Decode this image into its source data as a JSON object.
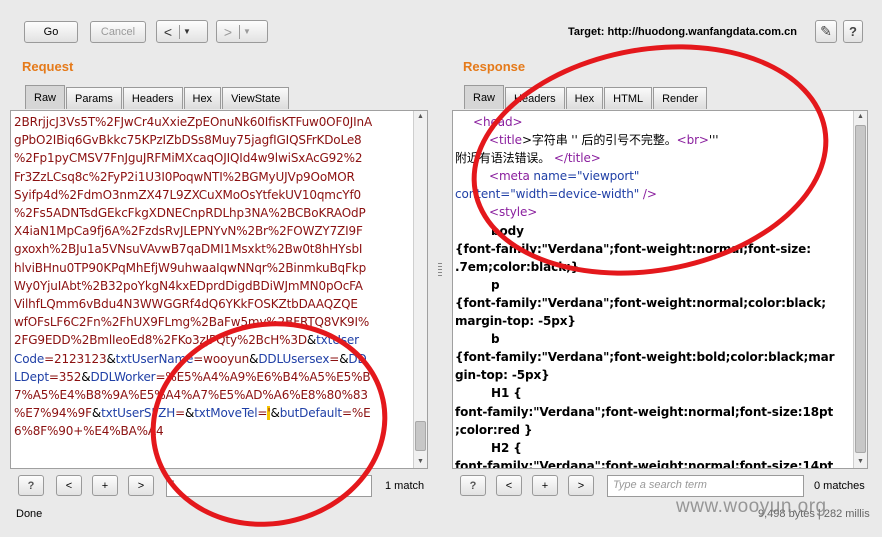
{
  "toolbar": {
    "go_label": "Go",
    "cancel_label": "Cancel",
    "back_symbol": "<",
    "forward_symbol": ">",
    "dropdown_symbol": "▼",
    "target_label": "Target: http://huodong.wanfangdata.com.cn",
    "edit_icon": "✎",
    "help_label": "?"
  },
  "request": {
    "title": "Request",
    "tabs": [
      "Raw",
      "Params",
      "Headers",
      "Hex",
      "ViewState"
    ],
    "active_tab": "Raw",
    "lines": [
      [
        {
          "t": "2BRrjjcJ3Vs5T%2FJwCr4uXxieZpEOnuNk60IfisKTFuw0OF0JInA",
          "c": "r"
        }
      ],
      [
        {
          "t": "gPbO2IBiq6GvBkkc75KPzIZbDSs8Muy75jagfIGIQSFrKDoLe8",
          "c": "r"
        }
      ],
      [
        {
          "t": "%2Fp1pyCMSV7FnJguJRFMiMXcaqOJIQId4w9lwiSxAcG92%2",
          "c": "r"
        }
      ],
      [
        {
          "t": "Fr3ZzLCsq8c%2FyP2i1U3I0PoqwNTI%2BGMyUJVp9OoMOR",
          "c": "r"
        }
      ],
      [
        {
          "t": "Syifp4d%2FdmO3nmZX47L9ZXCuXMoOsYtfekUV10qmcYf0",
          "c": "r"
        }
      ],
      [
        {
          "t": "%2Fs5ADNTsdGEkcFkgXDNECnpRDLhp3NA%2BCBoKRAOdP",
          "c": "r"
        }
      ],
      [
        {
          "t": "X4iaN1MpCa9fj6A%2FzdsRvJLEPNYvN%2Br%2FOWZY7ZI9F",
          "c": "r"
        }
      ],
      [
        {
          "t": "gxoxh%2BJu1a5VNsuVAvwB7qaDMI1Msxkt%2Bw0t8hHYsbI",
          "c": "r"
        }
      ],
      [
        {
          "t": "hlviBHnu0TP90KPqMhEfjW9uhwaaIqwNNqr%2BinmkuBqFkp",
          "c": "r"
        }
      ],
      [
        {
          "t": "Wy0YjuIAbt%2B32poYkgN4kxEDprdDigdBDiWJmMN0pOcFA",
          "c": "r"
        }
      ],
      [
        {
          "t": "VilhfLQmm6vBdu4N3WWGGRf4dQ6YKkFOSKZtbDAAQZQE",
          "c": "r"
        }
      ],
      [
        {
          "t": "wfOFsLF6C2Fn%2FhUX9FLmg%2BaFw5mv%2BFRTQ8VK9I%",
          "c": "r"
        }
      ],
      [
        {
          "t": "2FG9EDD%2BmlIeoEd8%2FKo3zJPQty%2BcH%3D",
          "c": "r"
        },
        {
          "t": "&",
          "c": "k"
        },
        {
          "t": "txtUser",
          "c": "b"
        }
      ],
      [
        {
          "t": "Code",
          "c": "b"
        },
        {
          "t": "=2123123",
          "c": "r"
        },
        {
          "t": "&",
          "c": "k"
        },
        {
          "t": "txtUserName",
          "c": "b"
        },
        {
          "t": "=wooyun",
          "c": "r"
        },
        {
          "t": "&",
          "c": "k"
        },
        {
          "t": "DDLUsersex",
          "c": "b"
        },
        {
          "t": "=",
          "c": "r"
        },
        {
          "t": "&",
          "c": "k"
        },
        {
          "t": "DD",
          "c": "b"
        }
      ],
      [
        {
          "t": "LDept",
          "c": "b"
        },
        {
          "t": "=352",
          "c": "r"
        },
        {
          "t": "&",
          "c": "k"
        },
        {
          "t": "DDLWorker",
          "c": "b"
        },
        {
          "t": "=%E5%A4%A9%E6%B4%A5%E5%B",
          "c": "r"
        }
      ],
      [
        {
          "t": "7%A5%E4%B8%9A%E5%A4%A7%E5%AD%A6%E8%80%83",
          "c": "r"
        }
      ],
      [
        {
          "t": "%E7%94%9F",
          "c": "r"
        },
        {
          "t": "&",
          "c": "k"
        },
        {
          "t": "txtUserSFZH",
          "c": "b"
        },
        {
          "t": "=",
          "c": "r"
        },
        {
          "t": "&",
          "c": "k"
        },
        {
          "t": "txtMoveTel",
          "c": "b"
        },
        {
          "t": "='",
          "c": "r"
        },
        {
          "t": "&",
          "c": "k"
        },
        {
          "t": "butDefault",
          "c": "b"
        },
        {
          "t": "=%E",
          "c": "r"
        }
      ],
      [
        {
          "t": "6%8F%90+%E4%BA%A4",
          "c": "r"
        }
      ]
    ],
    "search_value": "'",
    "match_count": "1 match",
    "help_label": "?",
    "prev_label": "<",
    "add_label": "+",
    "next_label": ">"
  },
  "response": {
    "title": "Response",
    "tabs": [
      "Raw",
      "Headers",
      "Hex",
      "HTML",
      "Render"
    ],
    "active_tab": "Raw",
    "lines": [
      {
        "indent": 18,
        "parts": [
          {
            "t": "<",
            "c": "tag"
          },
          {
            "t": "head",
            "c": "tag"
          },
          {
            "t": ">",
            "c": "tag"
          }
        ]
      },
      {
        "indent": 34,
        "parts": [
          {
            "t": "<",
            "c": "tag"
          },
          {
            "t": "title",
            "c": "tag"
          },
          {
            "t": ">字符串 '' 后的引号不完整。",
            "c": "k"
          },
          {
            "t": "<br>",
            "c": "tag"
          },
          {
            "t": "'''",
            "c": "k"
          }
        ]
      },
      {
        "indent": 0,
        "parts": [
          {
            "t": "附近有语法错误。 ",
            "c": "k"
          },
          {
            "t": "</title>",
            "c": "tag"
          }
        ]
      },
      {
        "indent": 34,
        "parts": [
          {
            "t": "<",
            "c": "tag"
          },
          {
            "t": "meta",
            "c": "tag"
          },
          {
            "t": " name",
            "c": "attr"
          },
          {
            "t": "=\"viewport\"",
            "c": "val"
          }
        ]
      },
      {
        "indent": 0,
        "parts": [
          {
            "t": "content",
            "c": "attr"
          },
          {
            "t": "=\"width=device-width\"",
            "c": "val"
          },
          {
            "t": " />",
            "c": "tag"
          }
        ]
      },
      {
        "indent": 34,
        "parts": [
          {
            "t": "<",
            "c": "tag"
          },
          {
            "t": "style",
            "c": "tag"
          },
          {
            "t": ">",
            "c": "tag"
          }
        ]
      },
      {
        "indent": 36,
        "parts": [
          {
            "t": "body",
            "c": "bold"
          }
        ]
      },
      {
        "indent": 0,
        "parts": [
          {
            "t": "{font-family:\"Verdana\";font-weight:normal;font-size:",
            "c": "bold"
          }
        ]
      },
      {
        "indent": 0,
        "parts": [
          {
            "t": ".7em;color:black;}",
            "c": "bold"
          }
        ]
      },
      {
        "indent": 36,
        "parts": [
          {
            "t": "p",
            "c": "bold"
          }
        ]
      },
      {
        "indent": 0,
        "parts": [
          {
            "t": "{font-family:\"Verdana\";font-weight:normal;color:black;",
            "c": "bold"
          }
        ]
      },
      {
        "indent": 0,
        "parts": [
          {
            "t": "margin-top: -5px}",
            "c": "bold"
          }
        ]
      },
      {
        "indent": 36,
        "parts": [
          {
            "t": "b",
            "c": "bold"
          }
        ]
      },
      {
        "indent": 0,
        "parts": [
          {
            "t": "{font-family:\"Verdana\";font-weight:bold;color:black;mar",
            "c": "bold"
          }
        ]
      },
      {
        "indent": 0,
        "parts": [
          {
            "t": "gin-top: -5px}",
            "c": "bold"
          }
        ]
      },
      {
        "indent": 36,
        "parts": [
          {
            "t": "H1 {",
            "c": "bold"
          }
        ]
      },
      {
        "indent": 0,
        "parts": [
          {
            "t": "font-family:\"Verdana\";font-weight:normal;font-size:18pt",
            "c": "bold"
          }
        ]
      },
      {
        "indent": 0,
        "parts": [
          {
            "t": ";color:red }",
            "c": "bold"
          }
        ]
      },
      {
        "indent": 36,
        "parts": [
          {
            "t": "H2 {",
            "c": "bold"
          }
        ]
      },
      {
        "indent": 0,
        "parts": [
          {
            "t": "font-family:\"Verdana\";font-weight:normal;font-size:14pt",
            "c": "bold"
          }
        ]
      }
    ],
    "search_placeholder": "Type a search term",
    "match_count": "0 matches",
    "help_label": "?",
    "prev_label": "<",
    "add_label": "+",
    "next_label": ">"
  },
  "status": {
    "left": "Done",
    "right": "9,498 bytes | 282 millis",
    "watermark": "www.wooyun.org"
  },
  "colors": {
    "accent": "#e57a1a",
    "annotation": "#e4181c"
  }
}
